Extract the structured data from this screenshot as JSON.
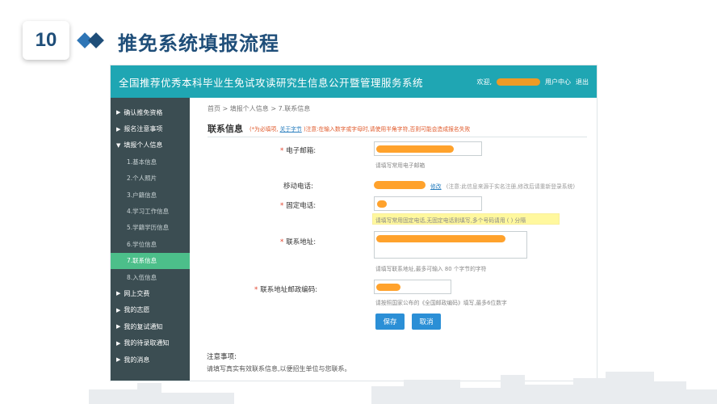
{
  "slide": {
    "number": "10",
    "title": "推免系统填报流程"
  },
  "app": {
    "site_title": "全国推荐优秀本科毕业生免试攻读研究生信息公开暨管理服务系统",
    "welcome": "欢迎,",
    "user_center": "用户中心",
    "logout": "退出"
  },
  "sidebar": {
    "items": [
      {
        "label": "确认推免资格",
        "type": "main"
      },
      {
        "label": "报名注意事项",
        "type": "main"
      },
      {
        "label": "填报个人信息",
        "type": "main"
      },
      {
        "label": "1.基本信息",
        "type": "sub"
      },
      {
        "label": "2.个人照片",
        "type": "sub"
      },
      {
        "label": "3.户籍信息",
        "type": "sub"
      },
      {
        "label": "4.学习工作信息",
        "type": "sub"
      },
      {
        "label": "5.学籍学历信息",
        "type": "sub"
      },
      {
        "label": "6.学位信息",
        "type": "sub"
      },
      {
        "label": "7.联系信息",
        "type": "sub",
        "active": true
      },
      {
        "label": "8.入伍信息",
        "type": "sub"
      },
      {
        "label": "网上交费",
        "type": "main"
      },
      {
        "label": "我的志愿",
        "type": "main"
      },
      {
        "label": "我的复试通知",
        "type": "main"
      },
      {
        "label": "我的待录取通知",
        "type": "main"
      },
      {
        "label": "我的消息",
        "type": "main"
      }
    ]
  },
  "breadcrumb": {
    "home": "首页",
    "sep": ">",
    "step1": "填报个人信息",
    "step2": "7.联系信息"
  },
  "section": {
    "title": "联系信息",
    "note_prefix": "(*为必填项,",
    "note_link": "关于字节",
    "note_suffix": ")注意:在输入数字或字母时,请使用半角字符,否则可能会造成报名失败"
  },
  "form": {
    "email": {
      "label": "电子邮箱:",
      "hint": "请填写常用电子邮箱"
    },
    "mobile": {
      "label": "移动电话:",
      "edit_link": "修改",
      "note": "(注意:此信息来源于实名注册,修改后请重新登录系统)"
    },
    "landline": {
      "label": "固定电话:",
      "hint": "请填写常用固定电话,无固定电话则填写,多个号码请用 ( ) 分隔"
    },
    "address": {
      "label": "联系地址:",
      "hint": "请填写联系地址,最多可输入 80 个字节的字符"
    },
    "postcode": {
      "label": "联系地址邮政编码:",
      "hint": "请按照国家公布的《全国邮政编码》填写,最多6位数字"
    }
  },
  "buttons": {
    "save": "保存",
    "cancel": "取消"
  },
  "notice": {
    "title": "注意事项:",
    "text": "请填写真实有效联系信息,以便招生单位与您联系。"
  },
  "colors": {
    "topbar": "#1fa6b3",
    "sidebar": "#3b4d52",
    "active_item": "#4cbf8a",
    "button": "#2b8fd6",
    "redaction": "#ff9a1a",
    "title": "#1f4e79"
  }
}
